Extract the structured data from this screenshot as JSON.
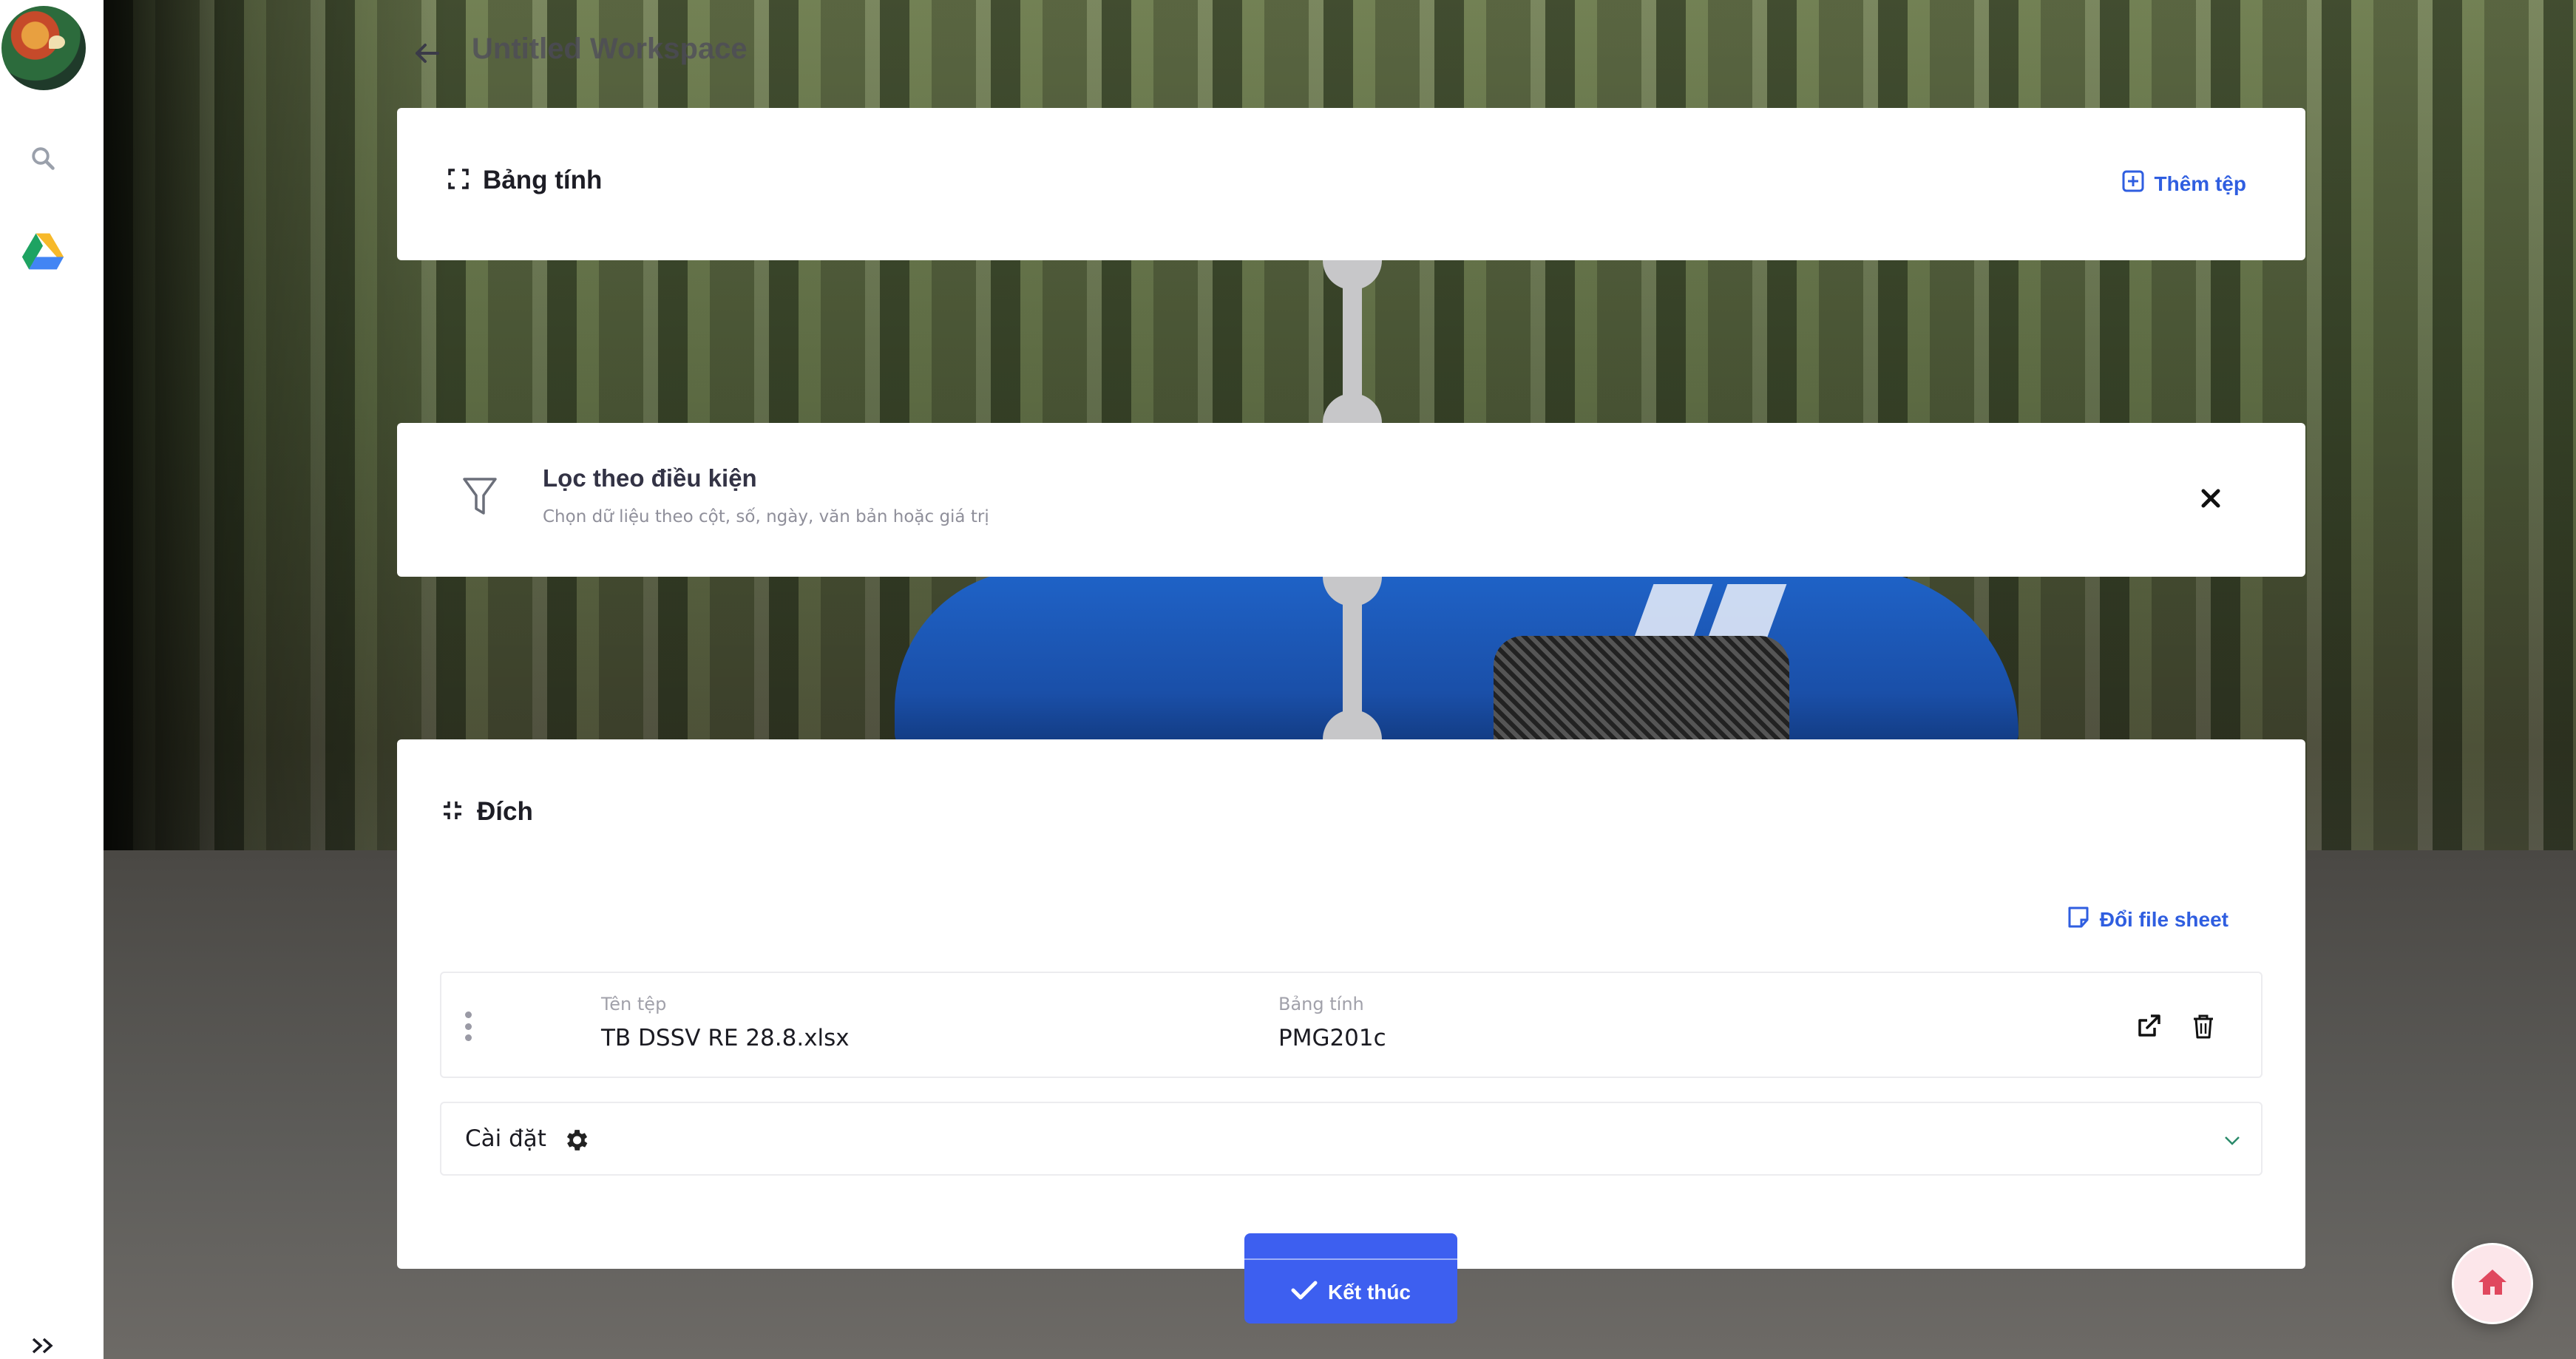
{
  "workspace": {
    "title": "Untitled Workspace"
  },
  "sidebar": {
    "icons": [
      "avatar",
      "search-icon",
      "google-drive-icon",
      "double-chevron-right-icon"
    ]
  },
  "source_card": {
    "title": "Bảng tính",
    "add_file_label": "Thêm tệp"
  },
  "filter_card": {
    "title": "Lọc theo điều kiện",
    "subtitle": "Chọn dữ liệu theo cột, số, ngày, văn bản hoặc giá trị"
  },
  "destination_card": {
    "title": "Đích",
    "change_sheet_label": "Đổi file sheet",
    "file_row": {
      "file_name_label": "Tên tệp",
      "file_name_value": "TB DSSV RE 28.8.xlsx",
      "sheet_label": "Bảng tính",
      "sheet_value": "PMG201c"
    },
    "settings_label": "Cài đặt"
  },
  "finish_button": {
    "label": "Kết thúc"
  },
  "colors": {
    "accent": "#3d5ff0",
    "link": "#2f5ee0",
    "home_icon": "#e0485e",
    "connector": "#c7c7c9"
  }
}
